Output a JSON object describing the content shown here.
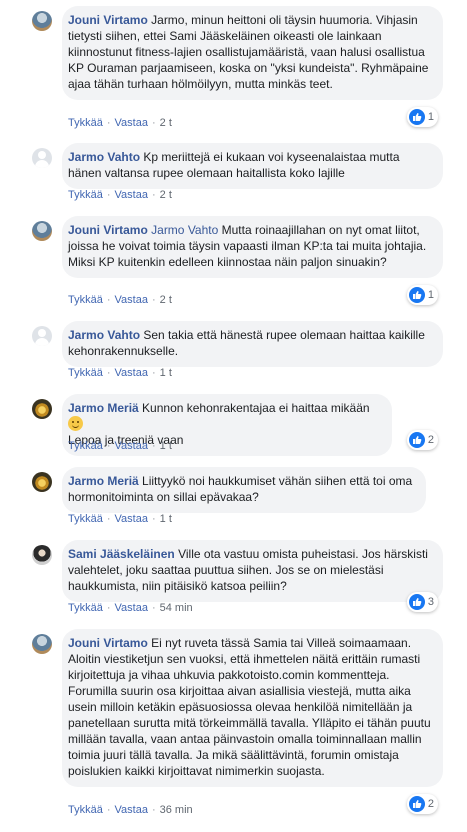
{
  "actions": {
    "like": "Tykkää",
    "reply": "Vastaa"
  },
  "comments": [
    {
      "author": "Jouni Virtamo",
      "mention": "",
      "text": "Jarmo, minun heittoni oli täysin huumoria. Vihjasin tietysti siihen, ettei Sami Jääskeläinen oikeasti ole lainkaan kiinnostunut fitness-lajien osallistujamääristä, vaan halusi osallistua KP Ouraman parjaamiseen, koska on \"yksi kundeista\". Ryhmäpaine ajaa tähän turhaan hölmöilyyn, mutta minkäs teet.",
      "time": "2 t",
      "reactions": "1"
    },
    {
      "author": "Jarmo Vahto",
      "mention": "",
      "text": "Kp meriittejä ei kukaan voi kyseenalaistaa mutta hänen valtansa rupee olemaan haitallista koko lajille",
      "time": "2 t",
      "reactions": ""
    },
    {
      "author": "Jouni Virtamo",
      "mention": "Jarmo Vahto",
      "text": "Mutta roinaajillahan on nyt omat liitot, joissa he voivat toimia täysin vapaasti ilman KP:ta tai muita johtajia. Miksi KP kuitenkin edelleen kiinnostaa näin paljon sinuakin?",
      "time": "2 t",
      "reactions": "1"
    },
    {
      "author": "Jarmo Vahto",
      "mention": "",
      "text": "Sen takia että hänestä rupee olemaan haittaa kaikille kehonrakennukselle.",
      "time": "1 t",
      "reactions": ""
    },
    {
      "author": "Jarmo Meriä",
      "mention": "",
      "text": "Kunnon kehonrakentajaa ei haittaa mikään",
      "text2": "Lepoa ja treeniä vaan",
      "time": "1 t",
      "reactions": "2"
    },
    {
      "author": "Jarmo Meriä",
      "mention": "",
      "text": "Liittyykö noi haukkumiset vähän siihen että toi oma hormonitoiminta on sillai epävakaa?",
      "time": "1 t",
      "reactions": ""
    },
    {
      "author": "Sami Jääskeläinen",
      "mention": "",
      "text": "Ville ota vastuu omista puheistasi. Jos härskisti valehtelet, joku saattaa puuttua siihen. Jos se on mielestäsi haukkumista, niin pitäisikö katsoa peiliin?",
      "time": "54 min",
      "reactions": "3"
    },
    {
      "author": "Jouni Virtamo",
      "mention": "",
      "text": "Ei nyt ruveta tässä Samia tai Villeä soimaamaan. Aloitin viestiketjun sen vuoksi, että ihmettelen näitä erittäin rumasti kirjoitettuja ja vihaa uhkuvia pakkotoisto.comin kommentteja. Forumilla suurin osa kirjoittaa aivan asiallisia viestejä, mutta aika usein milloin ketäkin epäsuosiossa olevaa henkilöä nimitellään ja panetellaan surutta mitä törkeimmällä tavalla. Ylläpito ei tähän puutu millään tavalla, vaan antaa päinvastoin omalla toiminnallaan mallin toimia juuri tällä tavalla. Ja mikä säälittävintä, forumin omistaja poislukien kaikki kirjoittavat nimimerkin suojasta.",
      "time": "36 min",
      "reactions": "2"
    }
  ]
}
